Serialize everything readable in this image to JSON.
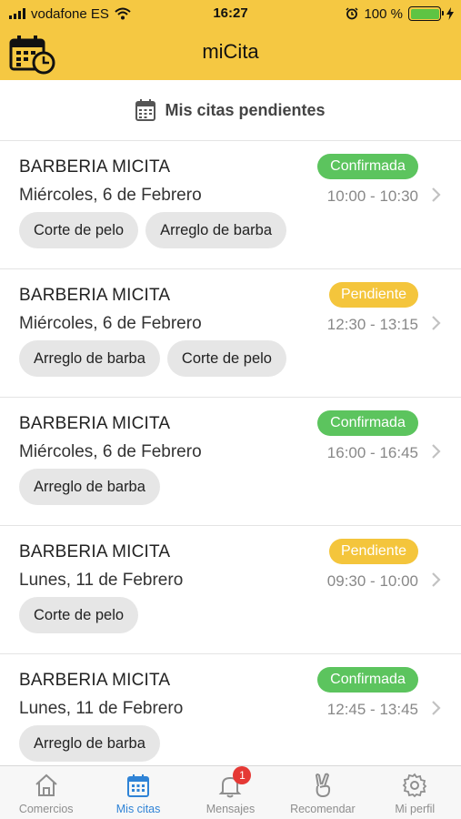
{
  "status_bar": {
    "carrier": "vodafone ES",
    "time": "16:27",
    "battery": "100 %"
  },
  "nav": {
    "title": "miCita",
    "left_icon": "calendar-clock-icon"
  },
  "subheader": {
    "icon": "calendar-icon",
    "title": "Mis citas pendientes"
  },
  "colors": {
    "header_bg": "#f5c842",
    "confirmed": "#5cc45e",
    "pending": "#f4c53c",
    "active_tab": "#2f83d6"
  },
  "appointments": [
    {
      "business": "BARBERIA MICITA",
      "date": "Miércoles, 6 de Febrero",
      "status": "Confirmada",
      "status_type": "confirmed",
      "time": "10:00 - 10:30",
      "services": [
        "Corte de pelo",
        "Arreglo de barba"
      ]
    },
    {
      "business": "BARBERIA MICITA",
      "date": "Miércoles, 6 de Febrero",
      "status": "Pendiente",
      "status_type": "pending",
      "time": "12:30 - 13:15",
      "services": [
        "Arreglo de barba",
        "Corte de pelo"
      ]
    },
    {
      "business": "BARBERIA MICITA",
      "date": "Miércoles, 6 de Febrero",
      "status": "Confirmada",
      "status_type": "confirmed",
      "time": "16:00 - 16:45",
      "services": [
        "Arreglo de barba"
      ]
    },
    {
      "business": "BARBERIA MICITA",
      "date": "Lunes, 11 de Febrero",
      "status": "Pendiente",
      "status_type": "pending",
      "time": "09:30 - 10:00",
      "services": [
        "Corte de pelo"
      ]
    },
    {
      "business": "BARBERIA MICITA",
      "date": "Lunes, 11 de Febrero",
      "status": "Confirmada",
      "status_type": "confirmed",
      "time": "12:45 - 13:45",
      "services": [
        "Arreglo de barba"
      ]
    }
  ],
  "tabbar": {
    "items": [
      {
        "label": "Comercios",
        "icon": "house-icon",
        "active": false
      },
      {
        "label": "Mis citas",
        "icon": "calendar-icon",
        "active": true
      },
      {
        "label": "Mensajes",
        "icon": "bell-icon",
        "active": false,
        "badge": "1"
      },
      {
        "label": "Recomendar",
        "icon": "peace-hand-icon",
        "active": false
      },
      {
        "label": "Mi perfil",
        "icon": "gear-icon",
        "active": false
      }
    ]
  }
}
